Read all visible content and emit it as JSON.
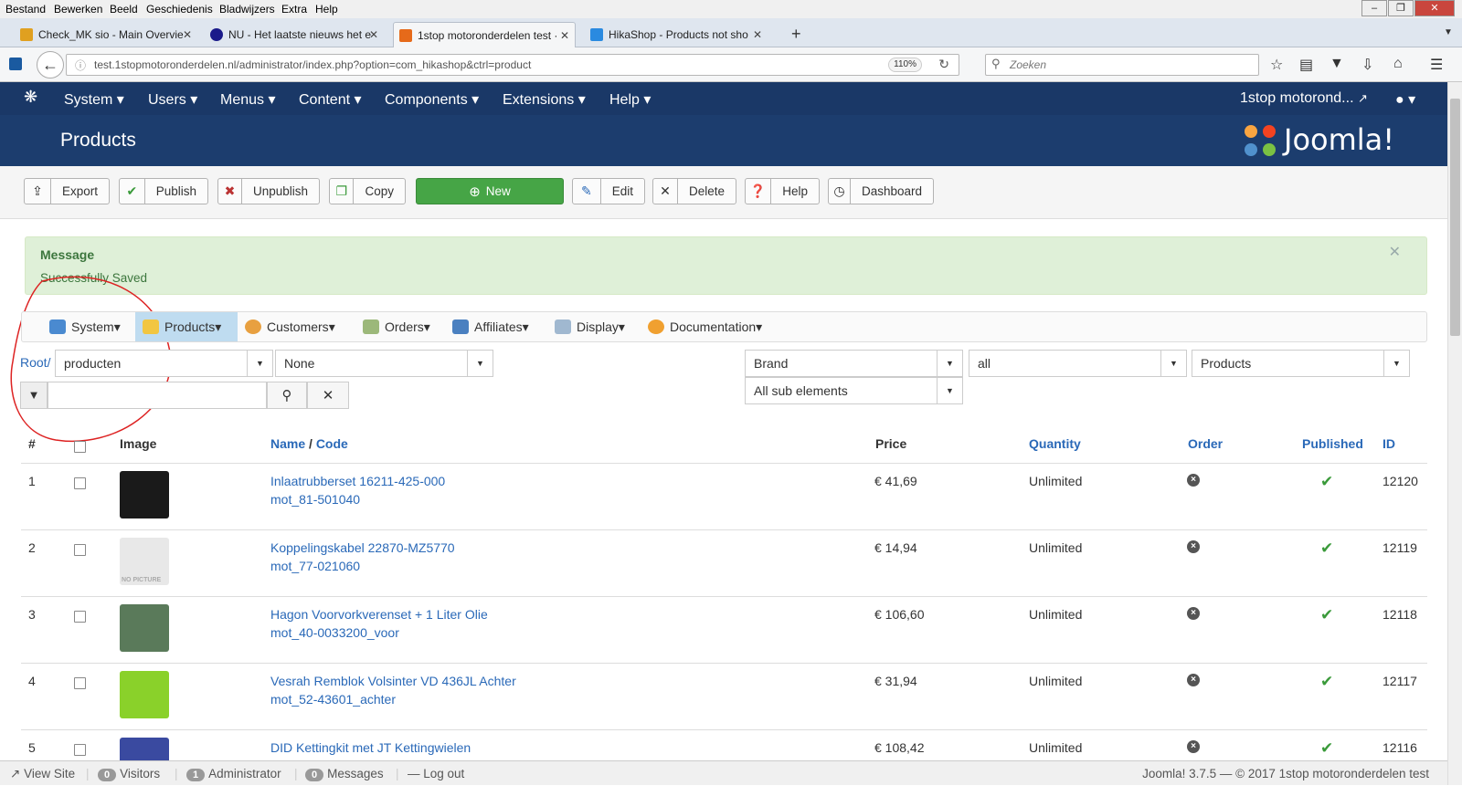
{
  "browser": {
    "menu": [
      "Bestand",
      "Bewerken",
      "Beeld",
      "Geschiedenis",
      "Bladwijzers",
      "Extra",
      "Help"
    ],
    "tabs": [
      {
        "label": "Check_MK sio - Main Overvie",
        "icon_color": "#e0a020"
      },
      {
        "label": "NU - Het laatste nieuws het e",
        "icon_color": "#1a1a8a"
      },
      {
        "label": "1stop motoronderdelen test ·",
        "icon_color": "#e66a1a"
      },
      {
        "label": "HikaShop - Products not sho",
        "icon_color": "#2a8ae0"
      }
    ],
    "url": "test.1stopmotoronderdelen.nl/administrator/index.php?option=com_hikashop&ctrl=product",
    "zoom": "110%",
    "search_placeholder": "Zoeken"
  },
  "joomla": {
    "menu": [
      "System",
      "Users",
      "Menus",
      "Content",
      "Components",
      "Extensions",
      "Help"
    ],
    "site_name": "1stop motorond...",
    "page_title": "Products",
    "logo_text": "Joomla!"
  },
  "toolbar": {
    "buttons": [
      {
        "label": "Export",
        "icon": "upload-icon"
      },
      {
        "label": "Publish",
        "icon": "check-icon"
      },
      {
        "label": "Unpublish",
        "icon": "unpublish-icon"
      },
      {
        "label": "Copy",
        "icon": "copy-icon"
      },
      {
        "label": "New",
        "icon": "plus-circle-icon"
      },
      {
        "label": "Edit",
        "icon": "edit-icon"
      },
      {
        "label": "Delete",
        "icon": "delete-icon"
      },
      {
        "label": "Help",
        "icon": "question-icon"
      },
      {
        "label": "Dashboard",
        "icon": "dashboard-icon"
      }
    ]
  },
  "message": {
    "heading": "Message",
    "text": "Successfully Saved"
  },
  "hikamenu": [
    "System",
    "Products",
    "Customers",
    "Orders",
    "Affiliates",
    "Display",
    "Documentation"
  ],
  "filters": {
    "root_link": "Root/",
    "category": "producten",
    "second": "None",
    "brand": "Brand",
    "all": "all",
    "products": "Products",
    "sub": "All sub elements",
    "search_value": ""
  },
  "table": {
    "headers": {
      "num": "#",
      "image": "Image",
      "name": "Name",
      "sep": "/",
      "code": "Code",
      "price": "Price",
      "quantity": "Quantity",
      "order": "Order",
      "published": "Published",
      "id": "ID"
    },
    "rows": [
      {
        "num": "1",
        "name": "Inlaatrubberset 16211-425-000",
        "code": "mot_81-501040",
        "price": "€ 41,69",
        "quantity": "Unlimited",
        "id": "12120",
        "thumb": "#1a1a1a"
      },
      {
        "num": "2",
        "name": "Koppelingskabel 22870-MZ5770",
        "code": "mot_77-021060",
        "price": "€ 14,94",
        "quantity": "Unlimited",
        "id": "12119",
        "thumb": "#e8e8e8",
        "thumb_text": "NO PICTURE"
      },
      {
        "num": "3",
        "name": "Hagon Voorvorkverenset + 1 Liter Olie",
        "code": "mot_40-0033200_voor",
        "price": "€ 106,60",
        "quantity": "Unlimited",
        "id": "12118",
        "thumb": "#5a7a5a"
      },
      {
        "num": "4",
        "name": "Vesrah Remblok Volsinter VD 436JL Achter",
        "code": "mot_52-43601_achter",
        "price": "€ 31,94",
        "quantity": "Unlimited",
        "id": "12117",
        "thumb": "#8ad12a"
      },
      {
        "num": "5",
        "name": "DID Kettingkit met JT Kettingwielen",
        "code": "",
        "price": "€ 108,42",
        "quantity": "Unlimited",
        "id": "12116",
        "thumb": "#3a4aa0"
      }
    ]
  },
  "footer": {
    "view_site": "View Site",
    "visitors_count": "0",
    "visitors": "Visitors",
    "admin_count": "1",
    "admin": "Administrator",
    "messages_count": "0",
    "messages": "Messages",
    "logout": "Log out",
    "version": "Joomla! 3.7.5 — © 2017 1stop motoronderdelen test"
  }
}
